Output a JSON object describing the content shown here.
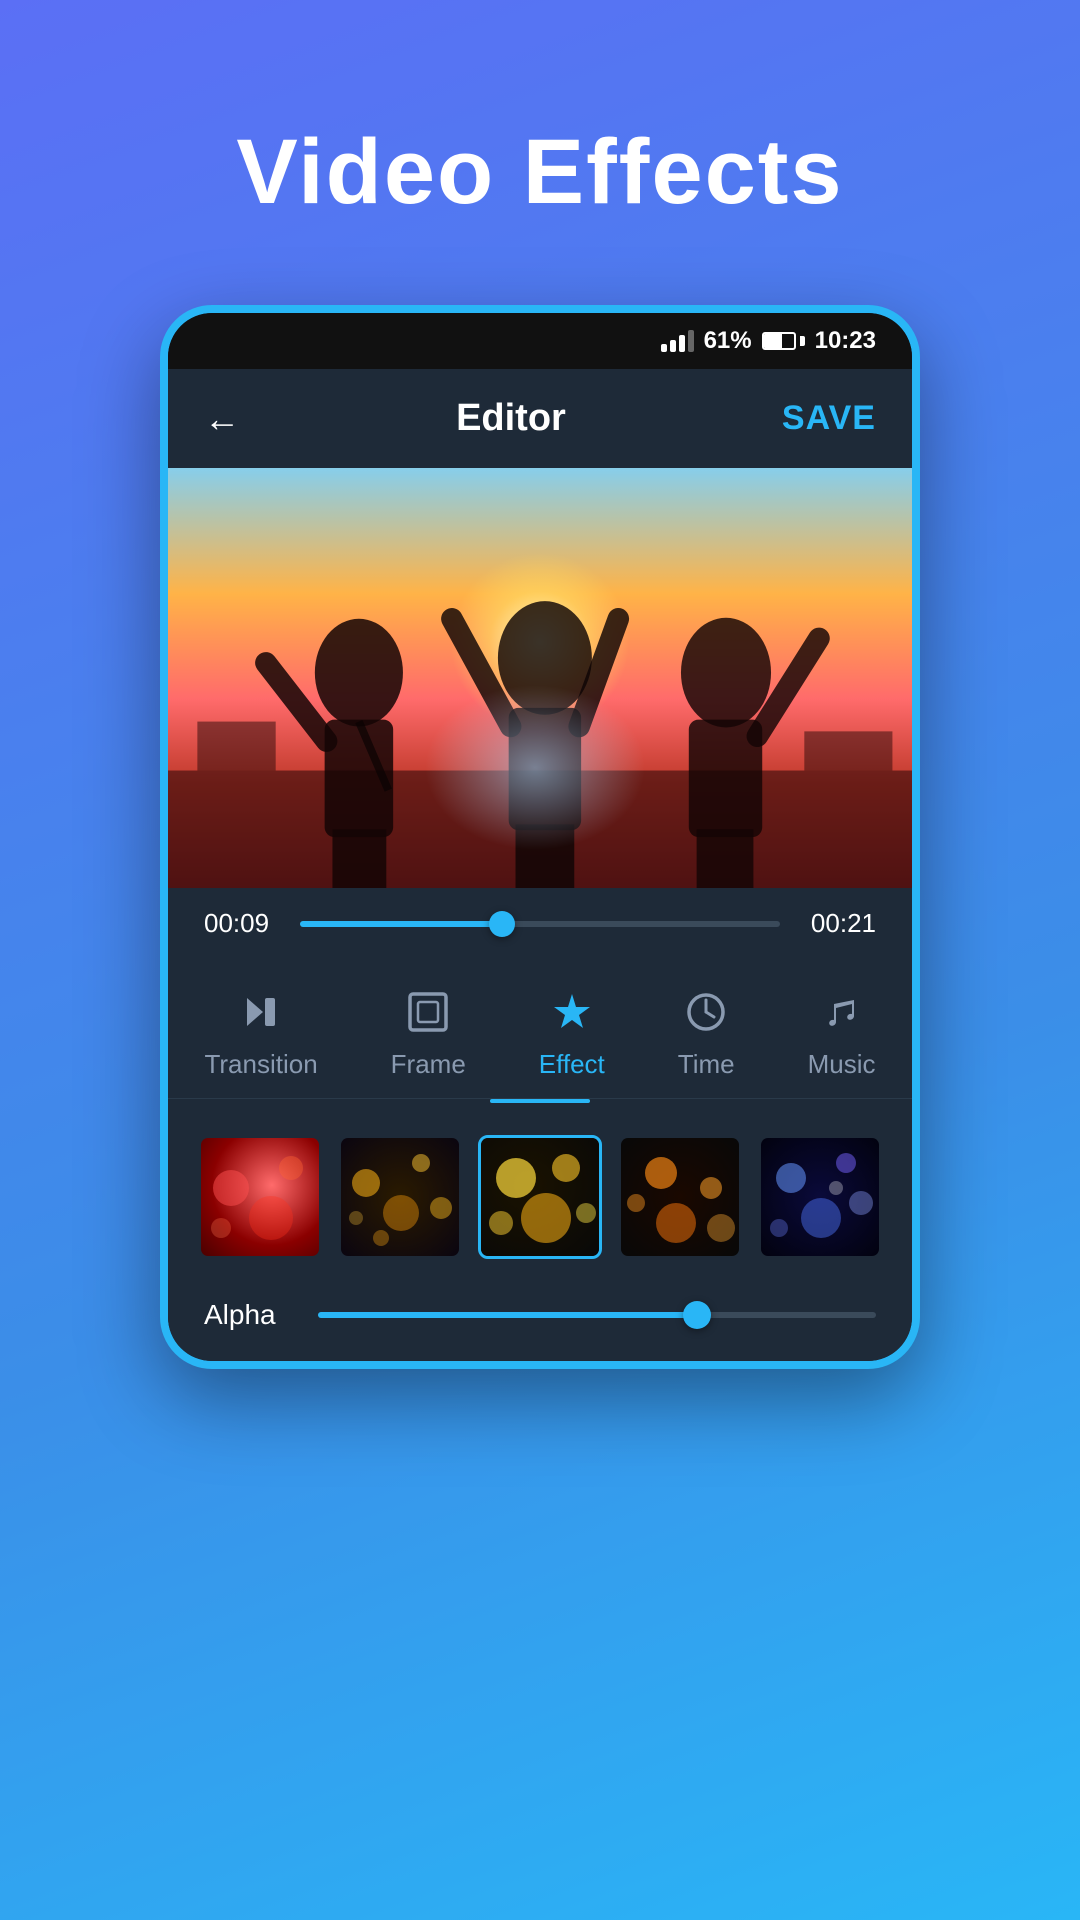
{
  "page": {
    "title": "Video Effects",
    "background_gradient_start": "#5b6ff5",
    "background_gradient_end": "#29b6f6"
  },
  "status_bar": {
    "battery_percent": "61%",
    "time": "10:23"
  },
  "header": {
    "back_label": "←",
    "title": "Editor",
    "save_label": "SAVE"
  },
  "timeline": {
    "time_start": "00:09",
    "time_end": "00:21",
    "progress_percent": 42
  },
  "tabs": [
    {
      "id": "transition",
      "label": "Transition",
      "active": false
    },
    {
      "id": "frame",
      "label": "Frame",
      "active": false
    },
    {
      "id": "effect",
      "label": "Effect",
      "active": true
    },
    {
      "id": "time",
      "label": "Time",
      "active": false
    },
    {
      "id": "music",
      "label": "Music",
      "active": false
    }
  ],
  "effects": [
    {
      "id": 1,
      "type": "red-bokeh",
      "selected": false
    },
    {
      "id": 2,
      "type": "dark-bokeh",
      "selected": false
    },
    {
      "id": 3,
      "type": "gold-bokeh",
      "selected": true
    },
    {
      "id": 4,
      "type": "orange-bokeh",
      "selected": false
    },
    {
      "id": 5,
      "type": "blue-bokeh",
      "selected": false
    }
  ],
  "alpha": {
    "label": "Alpha",
    "value": 68
  }
}
